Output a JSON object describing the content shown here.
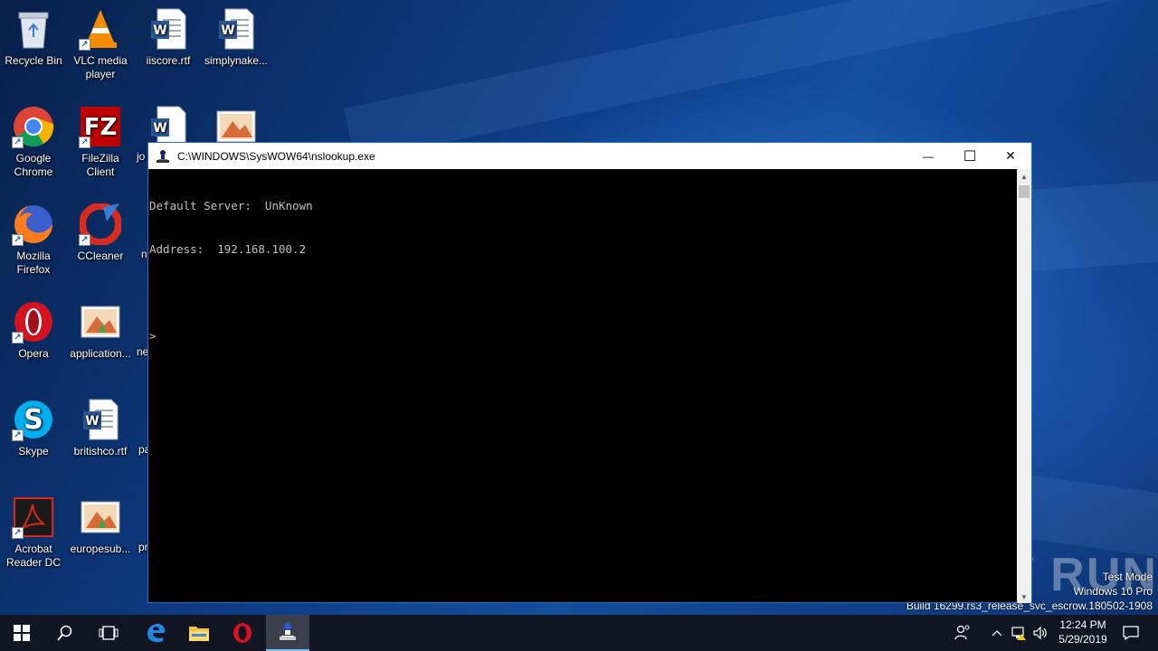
{
  "desktop": {
    "icons": [
      {
        "label": "Recycle Bin",
        "icon": "recycle-bin-icon"
      },
      {
        "label": "VLC media player",
        "icon": "vlc-icon"
      },
      {
        "label": "iiscore.rtf",
        "icon": "word-doc-icon"
      },
      {
        "label": "simplynake...",
        "icon": "word-doc-icon"
      },
      {
        "label": "Google Chrome",
        "icon": "chrome-icon"
      },
      {
        "label": "FileZilla Client",
        "icon": "filezilla-icon"
      },
      {
        "label": "Mozilla Firefox",
        "icon": "firefox-icon"
      },
      {
        "label": "CCleaner",
        "icon": "ccleaner-icon"
      },
      {
        "label": "Opera",
        "icon": "opera-icon"
      },
      {
        "label": "application...",
        "icon": "image-file-icon"
      },
      {
        "label": "Skype",
        "icon": "skype-icon"
      },
      {
        "label": "britishco.rtf",
        "icon": "word-doc-icon"
      },
      {
        "label": "Acrobat Reader DC",
        "icon": "acrobat-icon"
      },
      {
        "label": "europesub...",
        "icon": "image-file-icon"
      }
    ],
    "partial_labels": [
      "jo",
      "n",
      "ne",
      "pa",
      "pr"
    ]
  },
  "console": {
    "title": "C:\\WINDOWS\\SysWOW64\\nslookup.exe",
    "lines": [
      "Default Server:  UnKnown",
      "Address:  192.168.100.2",
      "",
      ">"
    ],
    "minimize_glyph": "—",
    "maximize_glyph": "☐",
    "close_glyph": "✕"
  },
  "watermark": {
    "text": "ANY RUN",
    "line1": "Test Mode",
    "line2": "Windows 10 Pro",
    "line3": "Build 16299.rs3_release_svc_escrow.180502-1908"
  },
  "taskbar": {
    "time": "12:24 PM",
    "date": "5/29/2019",
    "items": [
      "start-icon",
      "search-icon",
      "task-view-icon",
      "edge-icon",
      "file-explorer-icon",
      "opera-icon",
      "nslookup-icon"
    ]
  },
  "colors": {
    "taskbar": "#101521",
    "console_bg": "#000000",
    "console_text": "#c0c0c0",
    "window_border": "#2b6cc4"
  }
}
